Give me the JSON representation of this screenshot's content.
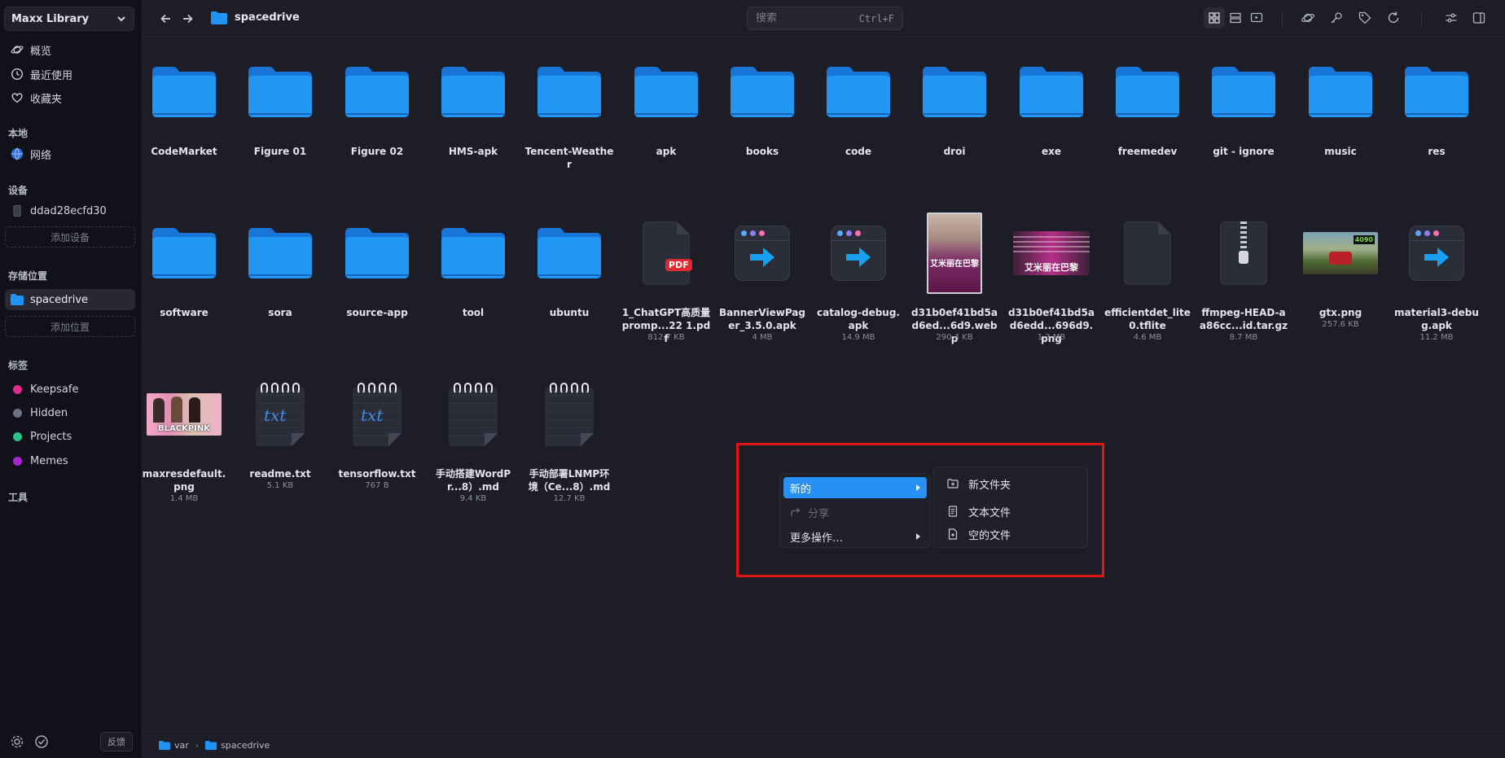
{
  "sidebar": {
    "library": "Maxx Library",
    "nav": [
      {
        "label": "概览",
        "icon": "planet-icon"
      },
      {
        "label": "最近使用",
        "icon": "clock-icon"
      },
      {
        "label": "收藏夹",
        "icon": "heart-icon"
      }
    ],
    "local_title": "本地",
    "network": "网络",
    "devices_title": "设备",
    "device": "ddad28ecfd30",
    "add_device": "添加设备",
    "locations_title": "存储位置",
    "location": "spacedrive",
    "add_location": "添加位置",
    "tags_title": "标签",
    "tags": [
      {
        "label": "Keepsafe",
        "color": "#e02a8c"
      },
      {
        "label": "Hidden",
        "color": "#6e7080"
      },
      {
        "label": "Projects",
        "color": "#33c08a"
      },
      {
        "label": "Memes",
        "color": "#a726d4"
      }
    ],
    "tools_title": "工具",
    "feedback": "反馈"
  },
  "topbar": {
    "path_title": "spacedrive",
    "search_placeholder": "搜索",
    "search_shortcut": "Ctrl+F"
  },
  "files": [
    {
      "name": "CodeMarket",
      "kind": "folder"
    },
    {
      "name": "Figure 01",
      "kind": "folder"
    },
    {
      "name": "Figure 02",
      "kind": "folder"
    },
    {
      "name": "HMS-apk",
      "kind": "folder"
    },
    {
      "name": "Tencent-Weather",
      "kind": "folder"
    },
    {
      "name": "apk",
      "kind": "folder"
    },
    {
      "name": "books",
      "kind": "folder"
    },
    {
      "name": "code",
      "kind": "folder"
    },
    {
      "name": "droi",
      "kind": "folder"
    },
    {
      "name": "exe",
      "kind": "folder"
    },
    {
      "name": "freemedev",
      "kind": "folder"
    },
    {
      "name": "git - ignore",
      "kind": "folder"
    },
    {
      "name": "music",
      "kind": "folder"
    },
    {
      "name": "res",
      "kind": "folder"
    },
    {
      "name": "software",
      "kind": "folder"
    },
    {
      "name": "sora",
      "kind": "folder"
    },
    {
      "name": "source-app",
      "kind": "folder"
    },
    {
      "name": "tool",
      "kind": "folder"
    },
    {
      "name": "ubuntu",
      "kind": "folder"
    },
    {
      "name": "1_ChatGPT高质量promp...22 1.pdf",
      "kind": "pdf",
      "size": "812.7 KB",
      "badge": "PDF"
    },
    {
      "name": "BannerViewPager_3.5.0.apk",
      "kind": "apk",
      "size": "4 MB"
    },
    {
      "name": "catalog-debug.apk",
      "kind": "apk",
      "size": "14.9 MB"
    },
    {
      "name": "d31b0ef41bd5ad6ed...6d9.webp",
      "kind": "poster",
      "size": "290.4 KB",
      "caption": "艾米丽在巴黎"
    },
    {
      "name": "d31b0ef41bd5ad6edd...696d9.png",
      "kind": "banner",
      "size": "1.3 MB",
      "caption": "艾米丽在巴黎"
    },
    {
      "name": "efficientdet_lite0.tflite",
      "kind": "doc",
      "size": "4.6 MB"
    },
    {
      "name": "ffmpeg-HEAD-aa86cc...id.tar.gz",
      "kind": "zip",
      "size": "8.7 MB"
    },
    {
      "name": "gtx.png",
      "kind": "game",
      "size": "257.6 KB",
      "caption": "4090"
    },
    {
      "name": "material3-debug.apk",
      "kind": "apk",
      "size": "11.2 MB"
    },
    {
      "name": "maxresdefault.png",
      "kind": "blackpink",
      "size": "1.4 MB",
      "caption": "BLACKPINK"
    },
    {
      "name": "readme.txt",
      "kind": "txt",
      "size": "5.1 KB",
      "label": "txt"
    },
    {
      "name": "tensorflow.txt",
      "kind": "txt",
      "size": "767 B",
      "label": "txt"
    },
    {
      "name": "手动搭建WordPr...8）.md",
      "kind": "md",
      "size": "9.4 KB"
    },
    {
      "name": "手动部署LNMP环境（Ce...8）.md",
      "kind": "md",
      "size": "12.7 KB"
    }
  ],
  "context_menu": {
    "items": [
      {
        "label": "新的",
        "state": "selected",
        "submenu": true
      },
      {
        "label": "分享",
        "state": "disabled",
        "icon": "share-icon"
      },
      {
        "label": "更多操作…",
        "state": "normal",
        "submenu": true
      }
    ],
    "submenu": [
      {
        "label": "新文件夹",
        "icon": "folder-plus-icon"
      },
      {
        "label": "文本文件",
        "icon": "text-file-icon"
      },
      {
        "label": "空的文件",
        "icon": "file-plus-icon"
      }
    ]
  },
  "statusbar": {
    "crumbs": [
      "var",
      "spacedrive"
    ]
  },
  "colors": {
    "accent": "#2790f5",
    "folder": "#1f94f5",
    "highlight_frame": "#e01616"
  }
}
